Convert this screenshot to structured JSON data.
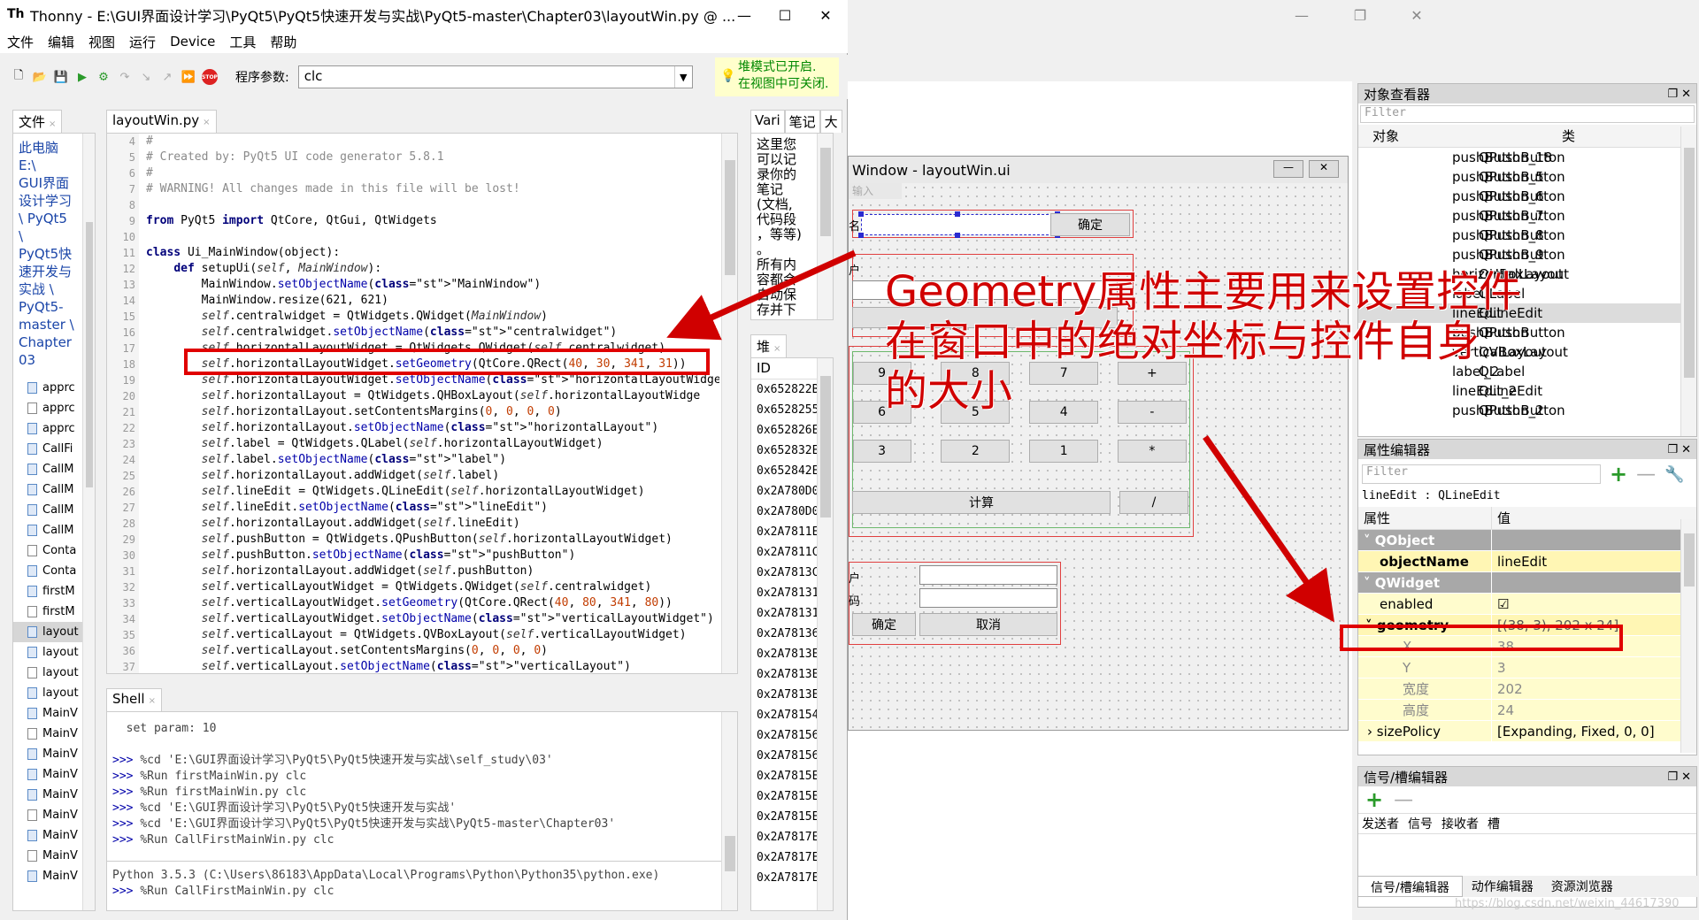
{
  "thonny": {
    "title": "Thonny  -  E:\\GUI界面设计学习\\PyQt5\\PyQt5快速开发与实战\\PyQt5-master\\Chapter03\\layoutWin.py  @ ...",
    "menu": [
      "文件",
      "编辑",
      "视图",
      "运行",
      "Device",
      "工具",
      "帮助"
    ],
    "toolbar_icons": [
      "new-file-icon",
      "open-file-icon",
      "save-icon",
      "run-icon",
      "debug-icon",
      "step-over-icon",
      "step-into-icon",
      "step-out-icon",
      "resume-icon",
      "stop-icon"
    ],
    "param_label": "程序参数:",
    "param_value": "clc",
    "notice_line1": "堆模式已开启.",
    "notice_line2": "在视图中可关闭.",
    "files_tab": "文件",
    "editor_tab": "layoutWin.py",
    "vars_tab": "Vari",
    "notes_tab": "笔记",
    "extra_tab": "大",
    "heap_tab": "堆",
    "shell_tab": "Shell",
    "files_path": [
      "此电脑",
      "E:\\",
      "GUI界面",
      "设计学习",
      "\\ PyQt5",
      "\\",
      "PyQt5快",
      "速开发与",
      "实战 \\",
      "PyQt5-",
      "master \\",
      "Chapter",
      "03"
    ],
    "files": [
      {
        "name": "apprc",
        "py": true
      },
      {
        "name": "apprc",
        "py": false
      },
      {
        "name": "apprc",
        "py": true
      },
      {
        "name": "CallFi",
        "py": true
      },
      {
        "name": "CallM",
        "py": true
      },
      {
        "name": "CallM",
        "py": true
      },
      {
        "name": "CallM",
        "py": true
      },
      {
        "name": "CallM",
        "py": true
      },
      {
        "name": "Conta",
        "py": false
      },
      {
        "name": "Conta",
        "py": true
      },
      {
        "name": "firstM",
        "py": true
      },
      {
        "name": "firstM",
        "py": false
      },
      {
        "name": "layout",
        "py": true,
        "selected": true
      },
      {
        "name": "layout",
        "py": true
      },
      {
        "name": "layout",
        "py": false
      },
      {
        "name": "layout",
        "py": true
      },
      {
        "name": "MainV",
        "py": true
      },
      {
        "name": "MainV",
        "py": false
      },
      {
        "name": "MainV",
        "py": true
      },
      {
        "name": "MainV",
        "py": true
      },
      {
        "name": "MainV",
        "py": true
      },
      {
        "name": "MainV",
        "py": false
      },
      {
        "name": "MainV",
        "py": true
      },
      {
        "name": "MainV",
        "py": false
      },
      {
        "name": "MainV",
        "py": true
      }
    ],
    "line_numbers": [
      4,
      5,
      6,
      7,
      8,
      9,
      10,
      11,
      12,
      13,
      14,
      15,
      16,
      17,
      18,
      19,
      20,
      21,
      22,
      23,
      24,
      25,
      26,
      27,
      28,
      29,
      30,
      31,
      32,
      33,
      34,
      35,
      36,
      37
    ],
    "code": [
      "#",
      "# Created by: PyQt5 UI code generator 5.8.1",
      "#",
      "# WARNING! All changes made in this file will be lost!",
      "",
      "from PyQt5 import QtCore, QtGui, QtWidgets",
      "",
      "class Ui_MainWindow(object):",
      "    def setupUi(self, MainWindow):",
      "        MainWindow.setObjectName(\"MainWindow\")",
      "        MainWindow.resize(621, 621)",
      "        self.centralwidget = QtWidgets.QWidget(MainWindow)",
      "        self.centralwidget.setObjectName(\"centralwidget\")",
      "        self.horizontalLayoutWidget = QtWidgets.QWidget(self.centralwidget)",
      "        self.horizontalLayoutWidget.setGeometry(QtCore.QRect(40, 30, 341, 31))",
      "        self.horizontalLayoutWidget.setObjectName(\"horizontalLayoutWidget\")",
      "        self.horizontalLayout = QtWidgets.QHBoxLayout(self.horizontalLayoutWidge",
      "        self.horizontalLayout.setContentsMargins(0, 0, 0, 0)",
      "        self.horizontalLayout.setObjectName(\"horizontalLayout\")",
      "        self.label = QtWidgets.QLabel(self.horizontalLayoutWidget)",
      "        self.label.setObjectName(\"label\")",
      "        self.horizontalLayout.addWidget(self.label)",
      "        self.lineEdit = QtWidgets.QLineEdit(self.horizontalLayoutWidget)",
      "        self.lineEdit.setObjectName(\"lineEdit\")",
      "        self.horizontalLayout.addWidget(self.lineEdit)",
      "        self.pushButton = QtWidgets.QPushButton(self.horizontalLayoutWidget)",
      "        self.pushButton.setObjectName(\"pushButton\")",
      "        self.horizontalLayout.addWidget(self.pushButton)",
      "        self.verticalLayoutWidget = QtWidgets.QWidget(self.centralwidget)",
      "        self.verticalLayoutWidget.setGeometry(QtCore.QRect(40, 80, 341, 80))",
      "        self.verticalLayoutWidget.setObjectName(\"verticalLayoutWidget\")",
      "        self.verticalLayout = QtWidgets.QVBoxLayout(self.verticalLayoutWidget)",
      "        self.verticalLayout.setContentsMargins(0, 0, 0, 0)",
      "        self.verticalLayout.setObjectName(\"verticalLayout\")"
    ],
    "notes_lines": [
      "这里您",
      "可以记",
      "录你的",
      "笔记",
      "(文档,",
      "代码段",
      "，等等)",
      "。",
      "所有内",
      "容都会",
      "自动保",
      "存并下"
    ],
    "heap_header": "ID",
    "heap_ids": [
      "0x652822B",
      "0x6528255",
      "0x652826E",
      "0x652832E",
      "0x652842E",
      "0x2A780D0",
      "0x2A780D0",
      "0x2A7811E",
      "0x2A7811C",
      "0x2A7813C",
      "0x2A78131",
      "0x2A78131",
      "0x2A78136",
      "0x2A7813E",
      "0x2A7813E",
      "0x2A7813E",
      "0x2A78154",
      "0x2A78156",
      "0x2A78156",
      "0x2A7815E",
      "0x2A7815E",
      "0x2A7815E",
      "0x2A7817E",
      "0x2A7817E",
      "0x2A7817E"
    ],
    "shell_lines": [
      {
        "p": "",
        "t": "  set param: 10"
      },
      {
        "p": "",
        "t": ""
      },
      {
        "p": ">>> ",
        "t": "%cd 'E:\\GUI界面设计学习\\PyQt5\\PyQt5快速开发与实战\\self_study\\03'"
      },
      {
        "p": ">>> ",
        "t": "%Run firstMainWin.py clc"
      },
      {
        "p": ">>> ",
        "t": "%Run firstMainWin.py clc"
      },
      {
        "p": ">>> ",
        "t": "%cd 'E:\\GUI界面设计学习\\PyQt5\\PyQt5快速开发与实战'"
      },
      {
        "p": ">>> ",
        "t": "%cd 'E:\\GUI界面设计学习\\PyQt5\\PyQt5快速开发与实战\\PyQt5-master\\Chapter03'"
      },
      {
        "p": ">>> ",
        "t": "%Run CallFirstMainWin.py clc"
      }
    ],
    "shell_python": "Python 3.5.3 (C:\\Users\\86183\\AppData\\Local\\Programs\\Python\\Python35\\python.exe)",
    "shell_last": "%Run CallFirstMainWin.py clc"
  },
  "designer": {
    "form_title": "Window - layoutWin.ui",
    "form_menu_hint": "输入",
    "btn_ok": "确定",
    "calc_buttons": [
      [
        "9",
        "8",
        "7",
        "+"
      ],
      [
        "6",
        "5",
        "4",
        "-"
      ],
      [
        "3",
        "2",
        "1",
        "*"
      ]
    ],
    "calc_compute": "计算",
    "calc_div": "/",
    "form_labels": [
      "名",
      "户",
      "码"
    ],
    "btn_ok2": "确定",
    "btn_cancel": "取消",
    "obj_inspector_title": "对象查看器",
    "filter_placeholder": "Filter",
    "obj_col1": "对象",
    "obj_col2": "类",
    "objects": [
      {
        "name": "pushButton_18",
        "cls": "QPushButton"
      },
      {
        "name": "pushButton_5",
        "cls": "QPushButton"
      },
      {
        "name": "pushButton_6",
        "cls": "QPushButton"
      },
      {
        "name": "pushButton_7",
        "cls": "QPushButton"
      },
      {
        "name": "pushButton_8",
        "cls": "QPushButton"
      },
      {
        "name": "pushButton_9",
        "cls": "QPushButton"
      },
      {
        "name": "horizontalLayout",
        "cls": "QHBoxLayout"
      },
      {
        "name": "label",
        "cls": "QLabel"
      },
      {
        "name": "lineEdit",
        "cls": "QLineEdit"
      },
      {
        "name": "pushButton",
        "cls": "QPushButton"
      },
      {
        "name": "verticalLayout",
        "cls": "QVBoxLayout"
      },
      {
        "name": "label_2",
        "cls": "QLabel"
      },
      {
        "name": "lineEdit_2",
        "cls": "QLineEdit"
      },
      {
        "name": "pushButton_2",
        "cls": "QPushButton"
      }
    ],
    "prop_editor_title": "属性编辑器",
    "prop_context": "lineEdit : QLineEdit",
    "prop_col1": "属性",
    "prop_col2": "值",
    "props": {
      "qobject": "QObject",
      "objectName_k": "objectName",
      "objectName_v": "lineEdit",
      "qwidget": "QWidget",
      "enabled_k": "enabled",
      "enabled_v": "☑",
      "geometry_k": "geometry",
      "geometry_v": "[(38, 3), 202 x 24]",
      "x_k": "X",
      "x_v": "38",
      "y_k": "Y",
      "y_v": "3",
      "w_k": "宽度",
      "w_v": "202",
      "h_k": "高度",
      "h_v": "24",
      "sp_k": "sizePolicy",
      "sp_v": "[Expanding, Fixed, 0, 0]"
    },
    "signal_title": "信号/槽编辑器",
    "signal_cols": [
      "发送者",
      "信号",
      "接收者",
      "槽"
    ],
    "bottom_tabs": [
      "信号/槽编辑器",
      "动作编辑器",
      "资源浏览器"
    ],
    "watermark": "https://blog.csdn.net/weixin_44617390"
  },
  "annotation": {
    "line1": "Geometry属性主要用来设置控件",
    "line2": "在窗口中的绝对坐标与控件自身",
    "line3": "的大小",
    "color": "#d00000"
  }
}
